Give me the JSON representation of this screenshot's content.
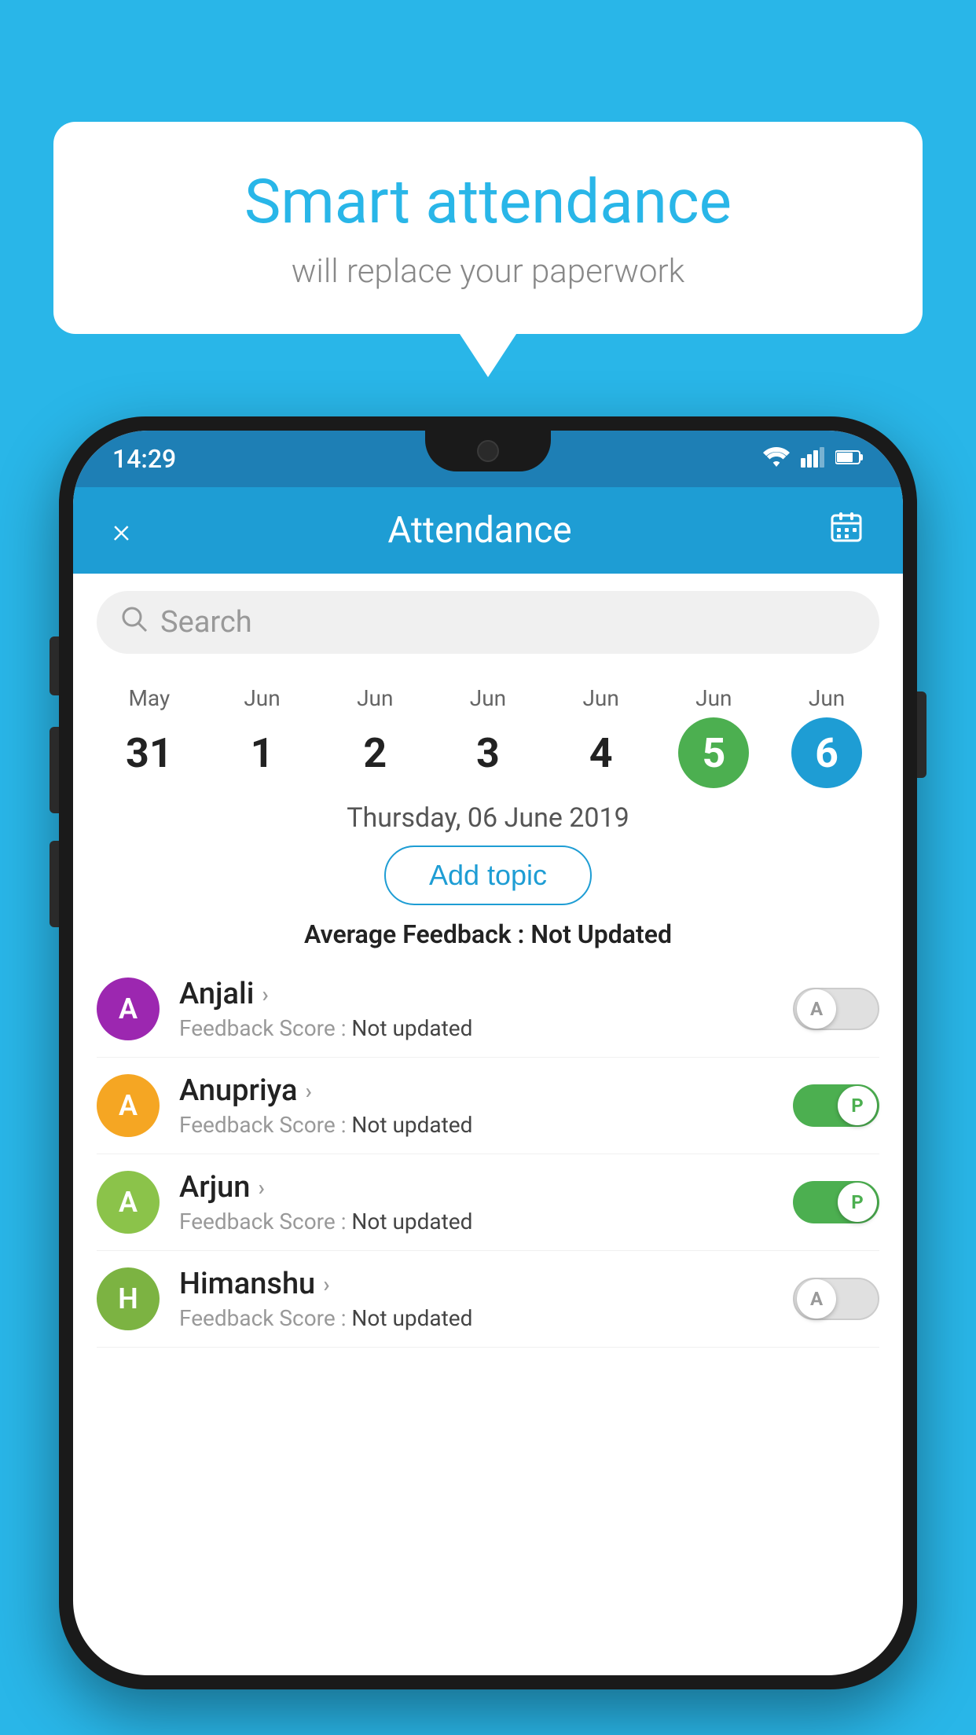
{
  "background_color": "#29b6e8",
  "speech_bubble": {
    "title": "Smart attendance",
    "subtitle": "will replace your paperwork"
  },
  "status_bar": {
    "time": "14:29",
    "icons": [
      "wifi",
      "signal",
      "battery"
    ]
  },
  "header": {
    "title": "Attendance",
    "close_label": "×",
    "calendar_label": "📅"
  },
  "search": {
    "placeholder": "Search"
  },
  "calendar": {
    "days": [
      {
        "month": "May",
        "num": "31",
        "state": "normal"
      },
      {
        "month": "Jun",
        "num": "1",
        "state": "normal"
      },
      {
        "month": "Jun",
        "num": "2",
        "state": "normal"
      },
      {
        "month": "Jun",
        "num": "3",
        "state": "normal"
      },
      {
        "month": "Jun",
        "num": "4",
        "state": "normal"
      },
      {
        "month": "Jun",
        "num": "5",
        "state": "today"
      },
      {
        "month": "Jun",
        "num": "6",
        "state": "selected"
      }
    ]
  },
  "selected_date": "Thursday, 06 June 2019",
  "add_topic_label": "Add topic",
  "average_feedback": {
    "label": "Average Feedback : ",
    "value": "Not Updated"
  },
  "students": [
    {
      "name": "Anjali",
      "avatar_letter": "A",
      "avatar_color": "#9c27b0",
      "feedback_label": "Feedback Score : ",
      "feedback_value": "Not updated",
      "toggle": "off",
      "toggle_label": "A"
    },
    {
      "name": "Anupriya",
      "avatar_letter": "A",
      "avatar_color": "#f5a623",
      "feedback_label": "Feedback Score : ",
      "feedback_value": "Not updated",
      "toggle": "on",
      "toggle_label": "P"
    },
    {
      "name": "Arjun",
      "avatar_letter": "A",
      "avatar_color": "#8bc34a",
      "feedback_label": "Feedback Score : ",
      "feedback_value": "Not updated",
      "toggle": "on",
      "toggle_label": "P"
    },
    {
      "name": "Himanshu",
      "avatar_letter": "H",
      "avatar_color": "#7cb342",
      "feedback_label": "Feedback Score : ",
      "feedback_value": "Not updated",
      "toggle": "off",
      "toggle_label": "A"
    }
  ]
}
